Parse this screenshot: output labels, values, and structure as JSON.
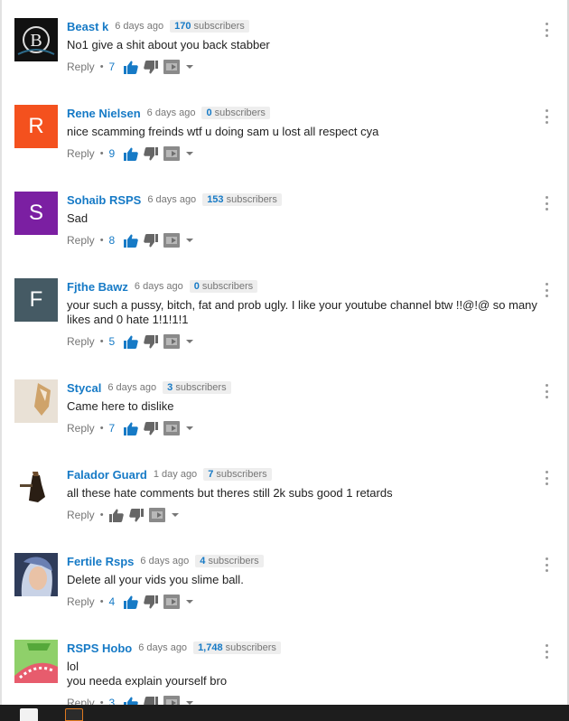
{
  "comments": [
    {
      "author": "Beast k",
      "time": "6 days ago",
      "subs_count": "170",
      "subs_label": "subscribers",
      "text": "No1 give a shit about you back stabber",
      "reply": "Reply",
      "sep": "•",
      "likes": "7",
      "avatar": {
        "type": "image",
        "color": "#1a1a1a"
      }
    },
    {
      "author": "Rene Nielsen",
      "time": "6 days ago",
      "subs_count": "0",
      "subs_label": "subscribers",
      "text": "nice scamming freinds wtf u doing sam u lost all respect cya",
      "reply": "Reply",
      "sep": "•",
      "likes": "9",
      "avatar": {
        "type": "letter",
        "letter": "R",
        "color": "#f4511e"
      }
    },
    {
      "author": "Sohaib RSPS",
      "time": "6 days ago",
      "subs_count": "153",
      "subs_label": "subscribers",
      "text": "Sad",
      "reply": "Reply",
      "sep": "•",
      "likes": "8",
      "avatar": {
        "type": "letter",
        "letter": "S",
        "color": "#7b1fa2"
      }
    },
    {
      "author": "Fjthe Bawz",
      "time": "6 days ago",
      "subs_count": "0",
      "subs_label": "subscribers",
      "text": "your such a pussy, bitch, fat and prob ugly. I like your youtube channel btw !!@!@ so many likes and 0 hate 1!1!1!1",
      "reply": "Reply",
      "sep": "•",
      "likes": "5",
      "avatar": {
        "type": "letter",
        "letter": "F",
        "color": "#455a64"
      }
    },
    {
      "author": "Stycal",
      "time": "6 days ago",
      "subs_count": "3",
      "subs_label": "subscribers",
      "text": "Came here to dislike",
      "reply": "Reply",
      "sep": "•",
      "likes": "7",
      "avatar": {
        "type": "image",
        "color": "#d9cbb8"
      }
    },
    {
      "author": "Falador Guard",
      "time": "1 day ago",
      "subs_count": "7",
      "subs_label": "subscribers",
      "text": "all these hate comments but theres still 2k subs good 1 retards",
      "reply": "Reply",
      "sep": "•",
      "likes": "",
      "avatar": {
        "type": "image",
        "color": "#ffffff"
      }
    },
    {
      "author": "Fertile Rsps",
      "time": "6 days ago",
      "subs_count": "4",
      "subs_label": "subscribers",
      "text": "Delete all your vids you slime ball.",
      "reply": "Reply",
      "sep": "•",
      "likes": "4",
      "avatar": {
        "type": "image",
        "color": "#3a4a6b"
      }
    },
    {
      "author": "RSPS Hobo",
      "time": "6 days ago",
      "subs_count": "1,748",
      "subs_label": "subscribers",
      "text": "lol\nyou needa explain yourself bro",
      "reply": "Reply",
      "sep": "•",
      "likes": "3",
      "avatar": {
        "type": "image",
        "color": "#7cc35a"
      }
    }
  ],
  "colors": {
    "author": "#167ac6",
    "like_active": "#167ac6",
    "meta": "#767676",
    "badge_bg": "#eeeeee"
  },
  "icons": {
    "like": "thumbs-up-icon",
    "dislike": "thumbs-down-icon",
    "share": "share-icon",
    "dropdown": "caret-down-icon",
    "menu": "more-vertical-icon"
  }
}
